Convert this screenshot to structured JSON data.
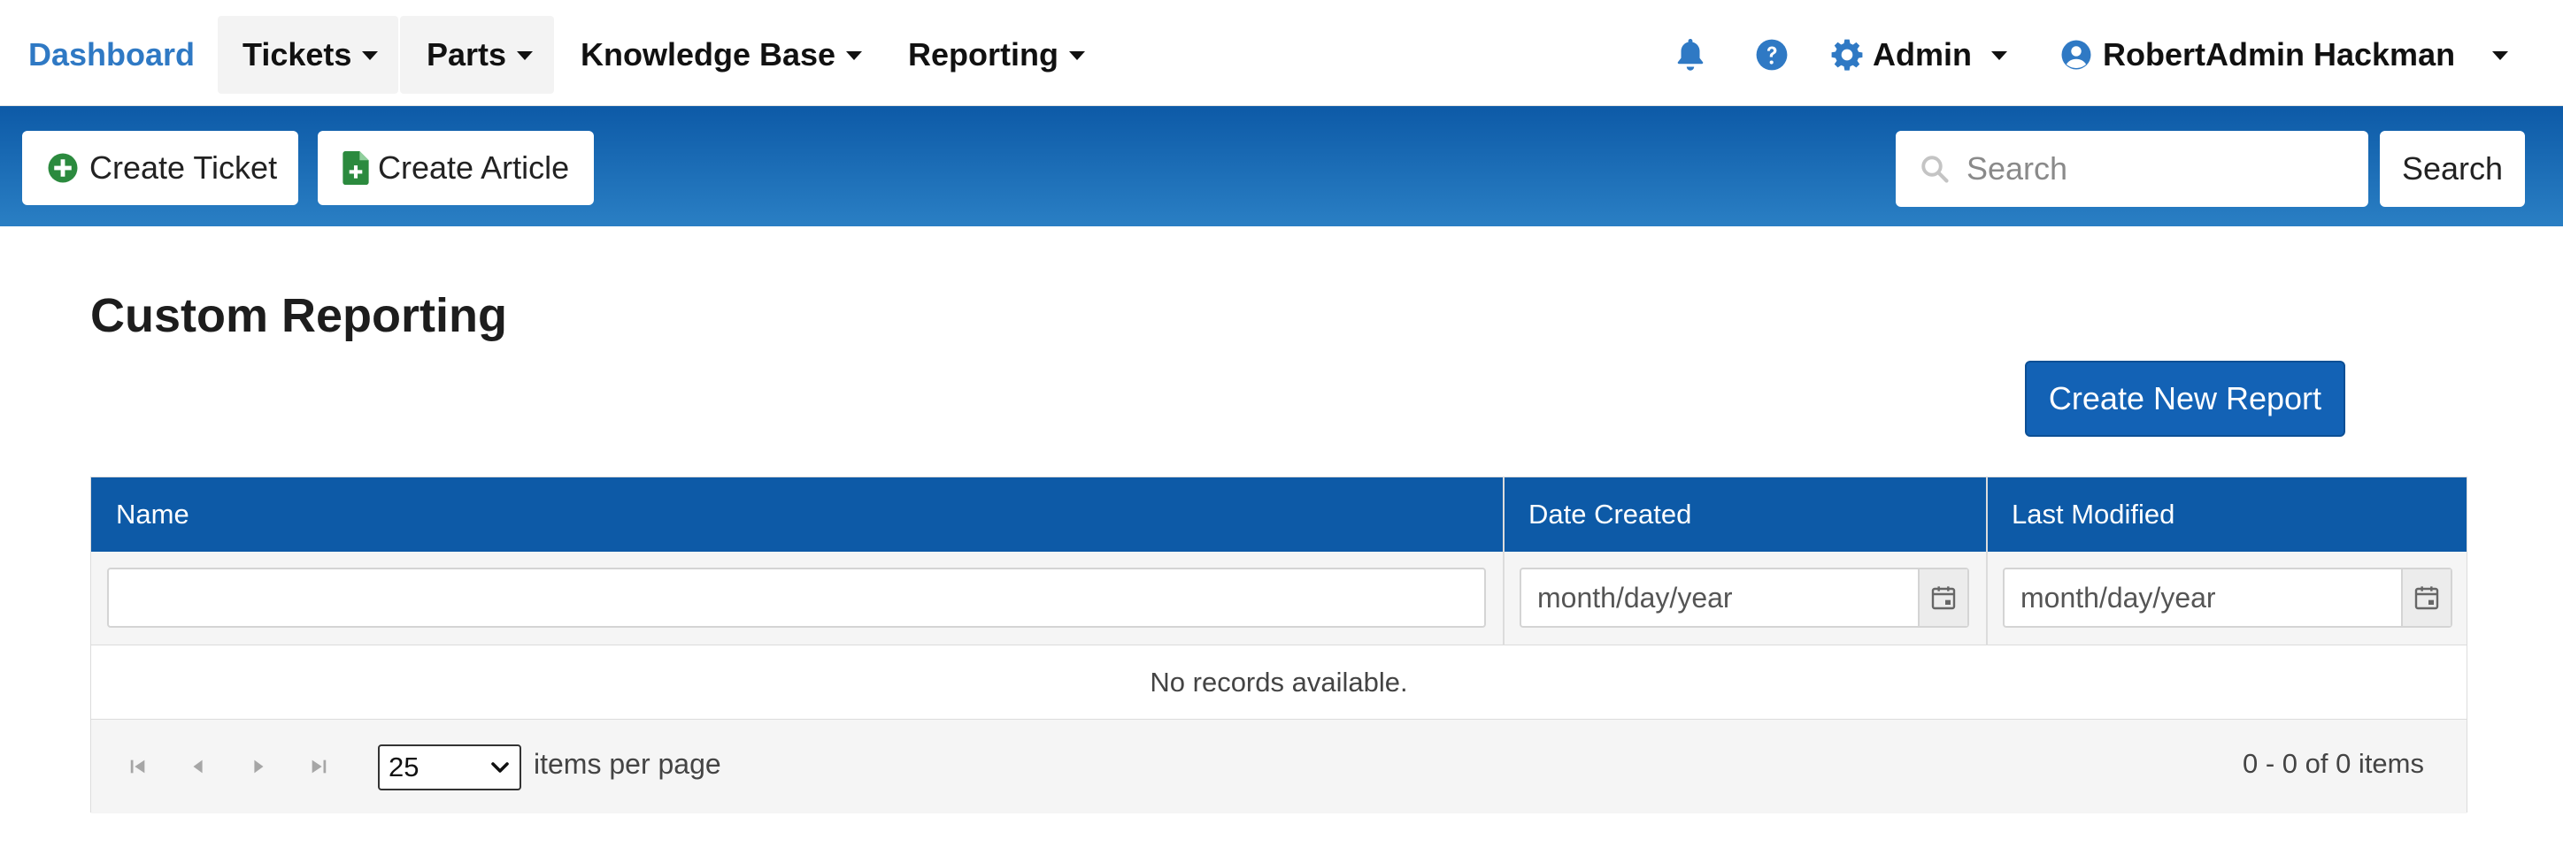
{
  "nav": {
    "brand": "Dashboard",
    "tickets": "Tickets",
    "parts": "Parts",
    "knowledge_base": "Knowledge Base",
    "reporting": "Reporting",
    "admin": "Admin",
    "user": "RobertAdmin Hackman",
    "icons": [
      "bell-icon",
      "help-circle-icon",
      "gear-icon",
      "user-circle-icon"
    ]
  },
  "actionbar": {
    "create_ticket": "Create Ticket",
    "create_article": "Create Article",
    "search_placeholder": "Search",
    "search_button": "Search"
  },
  "page": {
    "title": "Custom Reporting",
    "create_report": "Create New Report"
  },
  "grid": {
    "columns": [
      "Name",
      "Date Created",
      "Last Modified"
    ],
    "date_placeholder": "month/day/year",
    "empty_text": "No records available.",
    "page_size": "25",
    "page_size_label": "items per page",
    "pager_info": "0 - 0 of 0 items"
  },
  "colors": {
    "brand_text": "#2f79c4",
    "bar_dark": "#0d5aa7",
    "bar_light": "#2a7fc4",
    "primary_button": "#1362b5",
    "icon_green": "#2b8a3e"
  }
}
